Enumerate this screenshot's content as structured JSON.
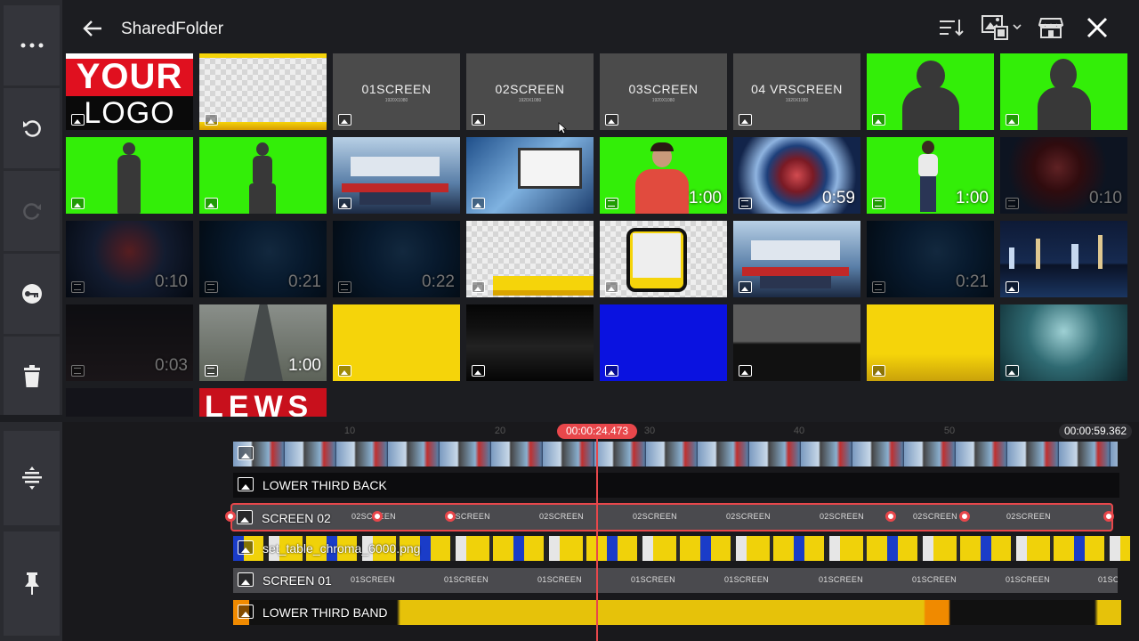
{
  "header": {
    "title": "SharedFolder",
    "icons": [
      "back-arrow-icon",
      "sort-icon",
      "media-type-filter-icon",
      "store-icon",
      "close-icon"
    ]
  },
  "sidebar": {
    "items": [
      "more-icon",
      "undo-icon",
      "redo-icon",
      "keyframe-key-icon",
      "delete-icon",
      "split-track-icon",
      "pin-icon"
    ]
  },
  "grid": {
    "logo_top": "YOUR",
    "logo_bottom": "LOGO",
    "screen_captions": [
      "01SCREEN",
      "02SCREEN",
      "03SCREEN",
      "04 VRSCREEN"
    ],
    "screen_sub": "1920X1080",
    "durations": {
      "anchor_red": "1:00",
      "news_globe": "0:59",
      "green_standing": "1:00",
      "dim_globe": "0:10",
      "row3_globe_a": "0:10",
      "row3_globe_b": "0:21",
      "row3_globe_c": "0:22",
      "row3_globe_d": "0:21",
      "street_night": "0:03",
      "highway": "1:00"
    },
    "partial_news": "LEWS"
  },
  "timeline": {
    "ruler_ticks": [
      "10",
      "20",
      "30",
      "40",
      "50"
    ],
    "playhead_time": "00:00:24.473",
    "end_time": "00:00:59.362",
    "tracks": [
      {
        "label": ""
      },
      {
        "label": "LOWER THIRD BACK"
      },
      {
        "label": "SCREEN 02",
        "repeat": "02SCREEN"
      },
      {
        "label": "set_table_chroma_6000.png"
      },
      {
        "label": "SCREEN 01",
        "repeat": "01SCREEN"
      },
      {
        "label": "LOWER THIRD BAND"
      }
    ]
  },
  "colors": {
    "accent": "#e8474b",
    "chroma_green": "#33ee08",
    "yellow": "#f5d40a",
    "blue": "#0a12e0"
  }
}
